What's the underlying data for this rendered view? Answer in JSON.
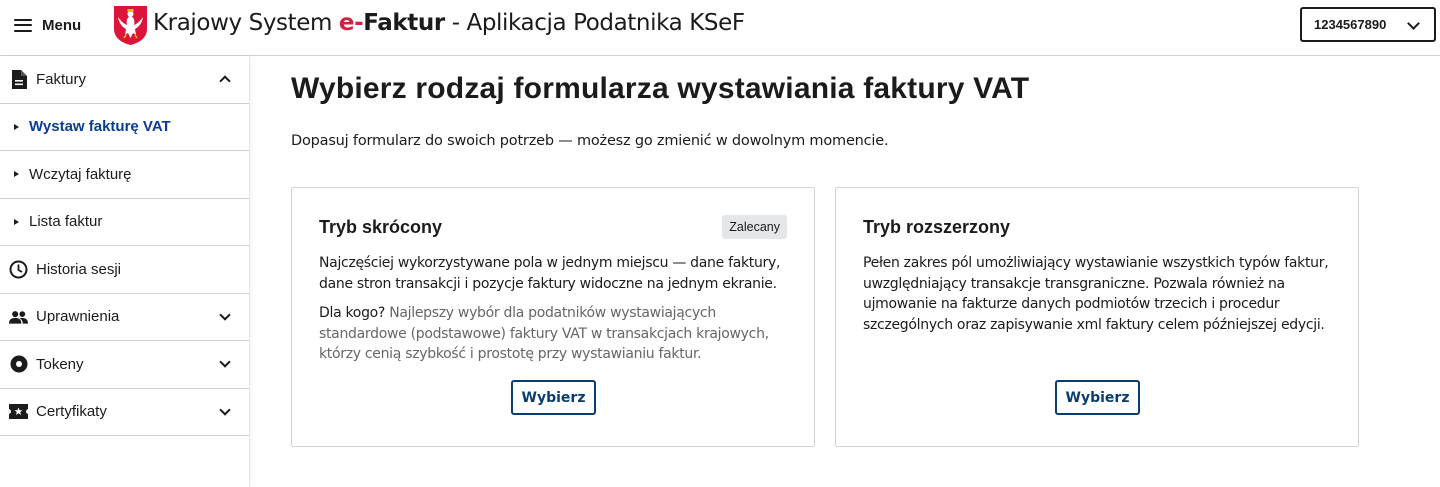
{
  "header": {
    "menu_label": "Menu",
    "title_prefix": "Krajowy System ",
    "title_e": "e-",
    "title_faktur": "Faktur",
    "title_suffix": " - Aplikacja Podatnika KSeF",
    "nip_value": "1234567890"
  },
  "sidebar": {
    "items": [
      {
        "label": "Faktury",
        "icon": "document-icon",
        "expanded": true
      },
      {
        "label": "Historia sesji",
        "icon": "clock-icon"
      },
      {
        "label": "Uprawnienia",
        "icon": "people-icon",
        "expanded": false
      },
      {
        "label": "Tokeny",
        "icon": "token-icon",
        "expanded": false
      },
      {
        "label": "Certyfikaty",
        "icon": "certificate-icon",
        "expanded": false
      }
    ],
    "subitems": [
      {
        "label": "Wystaw fakturę VAT",
        "active": true
      },
      {
        "label": "Wczytaj fakturę"
      },
      {
        "label": "Lista faktur"
      }
    ]
  },
  "main": {
    "title": "Wybierz rodzaj formularza wystawiania faktury VAT",
    "description": "Dopasuj formularz do swoich potrzeb — możesz go zmienić w dowolnym momencie.",
    "cards": [
      {
        "title": "Tryb skrócony",
        "badge": "Zalecany",
        "text": "Najczęściej wykorzystywane pola w jednym miejscu — dane faktury, dane stron transakcji i pozycje faktury widoczne na jednym ekranie.",
        "who_label": "Dla kogo?",
        "who_text": " Najlepszy wybór dla podatników wystawiających standardowe (podstawowe) faktury VAT w transakcjach krajowych, którzy cenią szybkość i prostotę przy wystawianiu faktur.",
        "button": "Wybierz"
      },
      {
        "title": "Tryb rozszerzony",
        "text": "Pełen zakres pól umożliwiający wystawianie wszystkich typów faktur, uwzględniający transakcje transgraniczne. Pozwala również na ujmowanie na fakturze danych podmiotów trzecich i procedur szczególnych oraz zapisywanie xml faktury celem późniejszej edycji.",
        "button": "Wybierz"
      }
    ]
  },
  "colors": {
    "accent": "#0a3d91",
    "brand_red": "#d4213d",
    "button_border": "#0a3d6e"
  }
}
